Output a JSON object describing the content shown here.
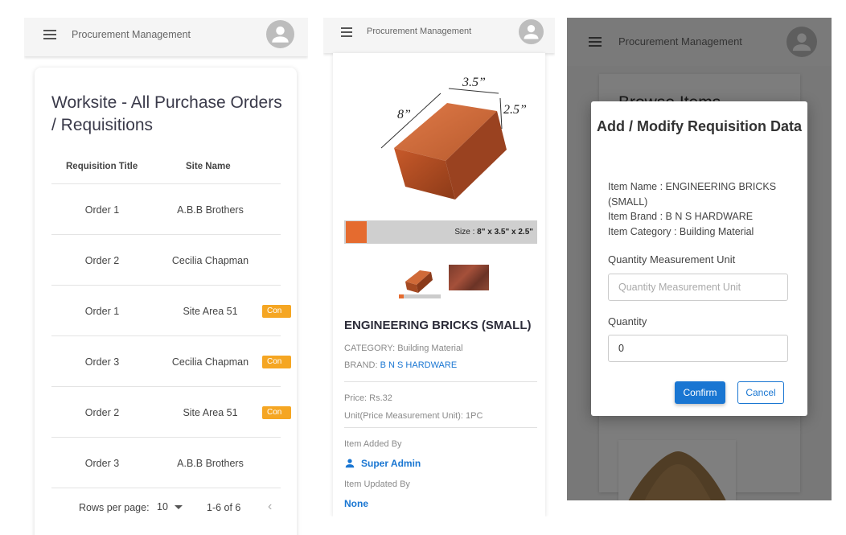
{
  "app": {
    "title": "Procurement Management"
  },
  "panel1": {
    "card_title": "Worksite - All Purchase Orders / Requisitions",
    "columns": [
      "Requisition Title",
      "Site Name"
    ],
    "rows": [
      {
        "title": "Order 1",
        "site": "A.B.B Brothers",
        "badge": ""
      },
      {
        "title": "Order 2",
        "site": "Cecilia Chapman",
        "badge": ""
      },
      {
        "title": "Order 1",
        "site": "Site Area 51",
        "badge": "Con"
      },
      {
        "title": "Order 3",
        "site": "Cecilia Chapman",
        "badge": "Con"
      },
      {
        "title": "Order 2",
        "site": "Site Area 51",
        "badge": "Con"
      },
      {
        "title": "Order 3",
        "site": "A.B.B Brothers",
        "badge": ""
      }
    ],
    "footer": {
      "rows_per_page_label": "Rows per page:",
      "rows_per_page_value": "10",
      "range": "1-6 of 6"
    }
  },
  "panel2": {
    "image_dims": {
      "top": "3.5”",
      "side": "2.5”",
      "length": "8”"
    },
    "size_label": "Size :",
    "size_value": "8\" x 3.5\" x 2.5\"",
    "product_title": "ENGINEERING BRICKS (SMALL)",
    "category": "CATEGORY: Building Material",
    "brand_label": "BRAND:",
    "brand_value": "B N S HARDWARE",
    "price": "Price: Rs.32",
    "unit": "Unit(Price Measurement Unit): 1PC",
    "added_by_label": "Item Added By",
    "added_by": "Super Admin",
    "updated_by_label": "Item Updated By",
    "updated_by": "None"
  },
  "panel3": {
    "bg_title": "Browse Items",
    "dialog": {
      "title": "Add / Modify Requisition Data",
      "item_name": "Item Name : ENGINEERING BRICKS (SMALL)",
      "item_brand": "Item Brand : B N S HARDWARE",
      "item_category": "Item Category : Building Material",
      "qmu_label": "Quantity Measurement Unit",
      "qmu_placeholder": "Quantity Measurement Unit",
      "qty_label": "Quantity",
      "qty_value": "0",
      "confirm": "Confirm",
      "cancel": "Cancel"
    }
  },
  "colors": {
    "primary": "#1976d2",
    "badge": "#f5a623",
    "appbar": "#f5f5f5"
  }
}
